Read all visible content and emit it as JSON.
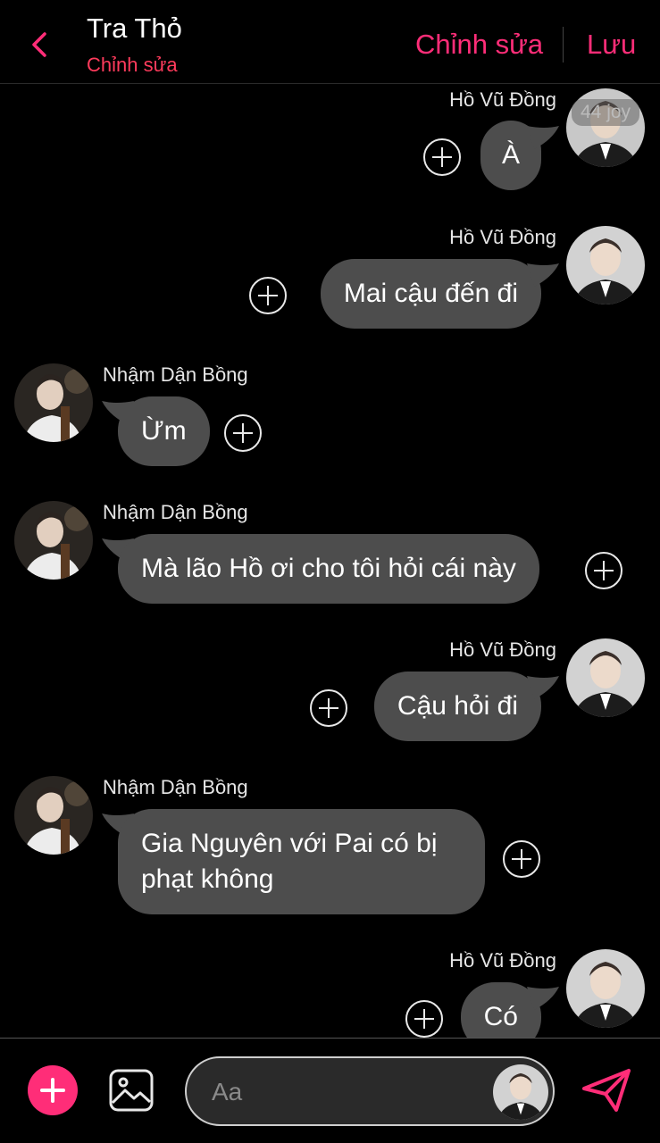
{
  "header": {
    "title": "Tra Thỏ",
    "subtitle": "Chỉnh sửa",
    "edit_label": "Chỉnh sửa",
    "save_label": "Lưu",
    "accent": "#ff2d78"
  },
  "chat": {
    "overlay_badge": "44 joy",
    "messages": [
      {
        "sender": "Hồ Vũ Đồng",
        "side": "right",
        "text": "À"
      },
      {
        "sender": "Hồ Vũ Đồng",
        "side": "right",
        "text": "Mai cậu đến đi"
      },
      {
        "sender": "Nhậm Dận Bồng",
        "side": "left",
        "text": "Ừm"
      },
      {
        "sender": "Nhậm Dận Bồng",
        "side": "left",
        "text": "Mà lão Hồ ơi cho tôi hỏi cái này"
      },
      {
        "sender": "Hồ Vũ Đồng",
        "side": "right",
        "text": "Cậu hỏi đi"
      },
      {
        "sender": "Nhậm Dận Bồng",
        "side": "left",
        "text": "Gia Nguyên với Pai có bị phạt không"
      },
      {
        "sender": "Hồ Vũ Đồng",
        "side": "right",
        "text": "Có"
      }
    ]
  },
  "input": {
    "placeholder": "Aa"
  },
  "icons": {
    "back": "chevron-left-icon",
    "add": "plus-icon",
    "image": "image-icon",
    "send": "send-icon"
  }
}
